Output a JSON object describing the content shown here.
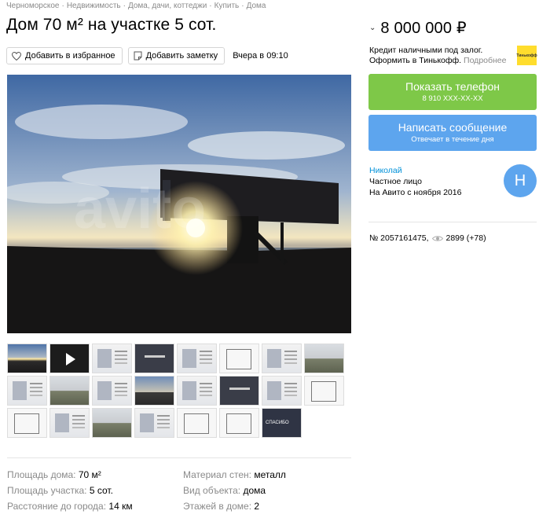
{
  "breadcrumbs": [
    "Черноморское",
    "Недвижимость",
    "Дома, дачи, коттеджи",
    "Купить",
    "Дома"
  ],
  "title": "Дом 70 м² на участке 5 сот.",
  "actions": {
    "favorite_label": "Добавить в избранное",
    "note_label": "Добавить заметку",
    "date": "Вчера в 09:10"
  },
  "price": "8 000 000 ₽",
  "credit": {
    "line1": "Кредит наличными под залог.",
    "line2": "Оформить в Тинькофф.",
    "more": "Подробнее",
    "logo": "Тинькофф"
  },
  "phone_button": {
    "label": "Показать телефон",
    "sub": "8 910 XXX-XX-XX"
  },
  "message_button": {
    "label": "Написать сообщение",
    "sub": "Отвечает в течение дня"
  },
  "seller": {
    "name": "Николай",
    "type": "Частное лицо",
    "since": "На Авито с ноября 2016",
    "initial": "Н"
  },
  "ad_meta": {
    "number": "№ 2057161475,",
    "views": "2899 (+78)"
  },
  "params": [
    {
      "key": "Площадь дома:",
      "value": "70 м²"
    },
    {
      "key": "Площадь участка:",
      "value": "5 сот."
    },
    {
      "key": "Расстояние до города:",
      "value": "14 км"
    },
    {
      "key": "Материал стен:",
      "value": "металл"
    },
    {
      "key": "Вид объекта:",
      "value": "дома"
    },
    {
      "key": "Этажей в доме:",
      "value": "2"
    }
  ],
  "colors": {
    "green": "#7ec848",
    "blue": "#5da5ee",
    "link": "#0091d9",
    "muted": "#8a8a8a"
  }
}
